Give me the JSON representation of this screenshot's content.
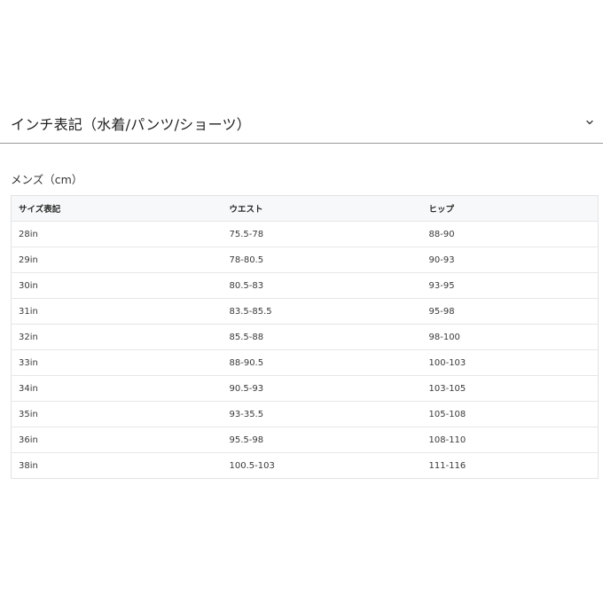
{
  "accordion": {
    "title": "インチ表記（水着/パンツ/ショーツ）",
    "chevron_icon": "chevron-down-icon"
  },
  "section": {
    "label": "メンズ（cm）"
  },
  "table": {
    "headers": [
      "サイズ表記",
      "ウエスト",
      "ヒップ"
    ],
    "rows": [
      [
        "28in",
        "75.5-78",
        "88-90"
      ],
      [
        "29in",
        "78-80.5",
        "90-93"
      ],
      [
        "30in",
        "80.5-83",
        "93-95"
      ],
      [
        "31in",
        "83.5-85.5",
        "95-98"
      ],
      [
        "32in",
        "85.5-88",
        "98-100"
      ],
      [
        "33in",
        "88-90.5",
        "100-103"
      ],
      [
        "34in",
        "90.5-93",
        "103-105"
      ],
      [
        "35in",
        "93-35.5",
        "105-108"
      ],
      [
        "36in",
        "95.5-98",
        "108-110"
      ],
      [
        "38in",
        "100.5-103",
        "111-116"
      ]
    ]
  }
}
